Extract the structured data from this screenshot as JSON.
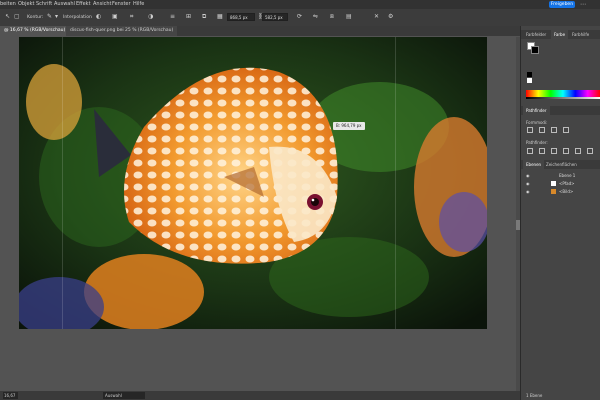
{
  "menubar": {
    "items": [
      "beiten",
      "Objekt",
      "Schrift",
      "Auswahl",
      "Effekt",
      "Ansicht",
      "Fenster",
      "Hilfe"
    ],
    "share_label": "Freigeben"
  },
  "controlbar": {
    "stroke_label": "Kontur:",
    "interpolation_label": "Interpolation",
    "width_field": "868,5 px",
    "height_field": "582,5 px"
  },
  "tabs": [
    {
      "label": "@ 16,67 % (RGB/Vorschau)",
      "active": true
    },
    {
      "label": "discus-fish-quer.png bei 25 % (RGB/Vorschau)",
      "active": false
    }
  ],
  "canvas": {
    "tooltip": "B: 964,79 px"
  },
  "status": {
    "zoom": "16,67",
    "tool": "Auswahl"
  },
  "panel": {
    "color_tabs": [
      "Farbfelder",
      "Farbe",
      "Farbhilfe"
    ],
    "pathfinder_tabs": [
      "Pathfinder"
    ],
    "shape_modes_label": "Formmodi:",
    "pathfinder_label": "Pathfinder:",
    "layers_tabs": [
      "Ebenen",
      "Zeichenflächen"
    ],
    "layers": [
      {
        "name": "Ebene 1",
        "level": 0
      },
      {
        "name": "<Pfad>",
        "level": 1
      },
      {
        "name": "<Bild>",
        "level": 1
      }
    ],
    "layers_count": "1 Ebene"
  },
  "colors": {
    "accent": "#1473e6"
  }
}
